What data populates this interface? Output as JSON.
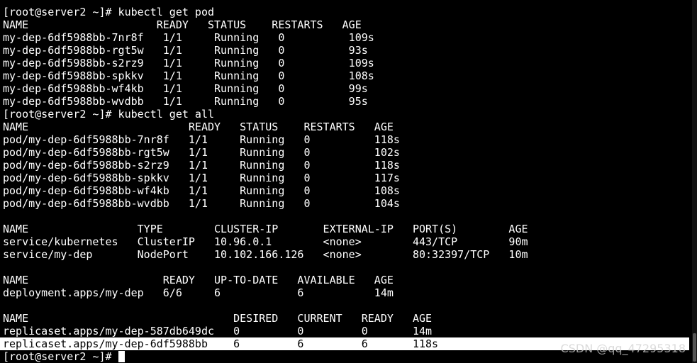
{
  "terminal": {
    "lines": [
      "[root@server2 ~]# kubectl get pod",
      "NAME                    READY   STATUS    RESTARTS   AGE",
      "my-dep-6df5988bb-7nr8f   1/1     Running   0          109s",
      "my-dep-6df5988bb-rgt5w   1/1     Running   0          93s",
      "my-dep-6df5988bb-s2rz9   1/1     Running   0          109s",
      "my-dep-6df5988bb-spkkv   1/1     Running   0          108s",
      "my-dep-6df5988bb-wf4kb   1/1     Running   0          99s",
      "my-dep-6df5988bb-wvdbb   1/1     Running   0          95s",
      "[root@server2 ~]# kubectl get all",
      "NAME                         READY   STATUS    RESTARTS   AGE",
      "pod/my-dep-6df5988bb-7nr8f   1/1     Running   0          118s",
      "pod/my-dep-6df5988bb-rgt5w   1/1     Running   0          102s",
      "pod/my-dep-6df5988bb-s2rz9   1/1     Running   0          118s",
      "pod/my-dep-6df5988bb-spkkv   1/1     Running   0          117s",
      "pod/my-dep-6df5988bb-wf4kb   1/1     Running   0          108s",
      "pod/my-dep-6df5988bb-wvdbb   1/1     Running   0          104s",
      "",
      "NAME                 TYPE        CLUSTER-IP       EXTERNAL-IP   PORT(S)        AGE",
      "service/kubernetes   ClusterIP   10.96.0.1        <none>        443/TCP        90m",
      "service/my-dep       NodePort    10.102.166.126   <none>        80:32397/TCP   10m",
      "",
      "NAME                     READY   UP-TO-DATE   AVAILABLE   AGE",
      "deployment.apps/my-dep   6/6     6            6           14m",
      "",
      "NAME                                DESIRED   CURRENT   READY   AGE",
      "replicaset.apps/my-dep-587db649dc   0         0         0       14m"
    ],
    "highlighted_line": "replicaset.apps/my-dep-6df5988bb    6         6         6       118s",
    "prompt": "[root@server2 ~]#"
  },
  "watermark": "CSDN @qq_47295318"
}
